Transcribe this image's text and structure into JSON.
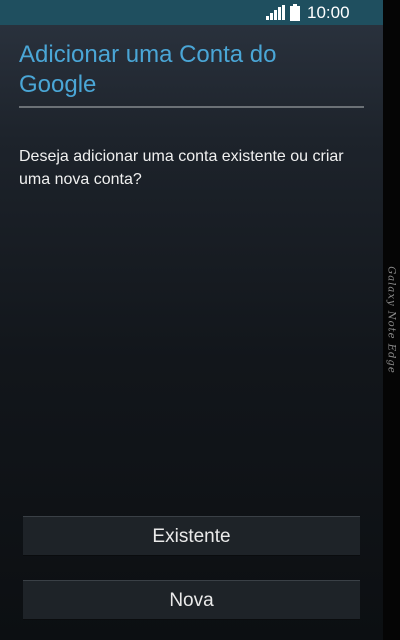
{
  "status_bar": {
    "time": "10:00",
    "signal_icon": "signal-icon",
    "battery_icon": "battery-icon",
    "color": "#1f4f5f"
  },
  "header": {
    "title": "Adicionar uma Conta do Google",
    "title_color": "#4aa6d6"
  },
  "body": {
    "question": "Deseja adicionar uma conta existente ou criar uma nova conta?"
  },
  "buttons": {
    "existing": "Existente",
    "new": "Nova"
  },
  "edge_panel": {
    "label": "Galaxy Note Edge"
  }
}
